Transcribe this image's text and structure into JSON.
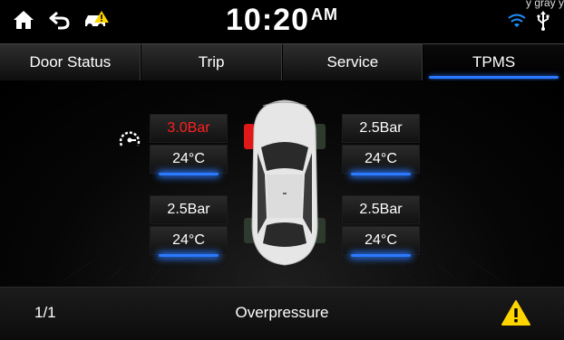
{
  "statusbar": {
    "time": "10:20",
    "ampm": "AM",
    "cut_text": "y gray y",
    "icons": [
      "home-icon",
      "back-icon",
      "car-alert-icon",
      "wifi-icon",
      "usb-icon"
    ]
  },
  "tabs": [
    {
      "label": "Door Status",
      "active": false
    },
    {
      "label": "Trip",
      "active": false
    },
    {
      "label": "Service",
      "active": false
    },
    {
      "label": "TPMS",
      "active": true
    }
  ],
  "tpms": {
    "front_left": {
      "pressure": "3.0Bar",
      "temp": "24°C",
      "alert": true
    },
    "front_right": {
      "pressure": "2.5Bar",
      "temp": "24°C",
      "alert": false
    },
    "rear_left": {
      "pressure": "2.5Bar",
      "temp": "24°C",
      "alert": false
    },
    "rear_right": {
      "pressure": "2.5Bar",
      "temp": "24°C",
      "alert": false
    }
  },
  "bottombar": {
    "page": "1/1",
    "status": "Overpressure"
  },
  "colors": {
    "accent": "#2a79ff",
    "alert": "#ff2020",
    "warning": "#ffd500",
    "wifi": "#1e90ff"
  }
}
